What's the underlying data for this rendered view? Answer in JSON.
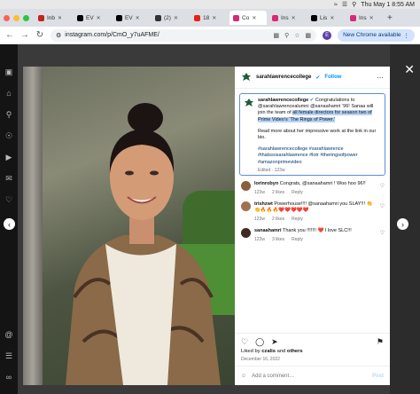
{
  "menubar": {
    "datetime": "Thu May 1  8:55 AM"
  },
  "tabs": [
    {
      "label": "Inb",
      "color": "#c5221f"
    },
    {
      "label": "EV",
      "color": "#000000"
    },
    {
      "label": "EV",
      "color": "#000000"
    },
    {
      "label": "(2)",
      "color": "#333333"
    },
    {
      "label": "18",
      "color": "#e62117"
    },
    {
      "label": "Co",
      "color": "#d62976",
      "active": true
    },
    {
      "label": "Ins",
      "color": "#d62976"
    },
    {
      "label": "Lis",
      "color": "#000000"
    },
    {
      "label": "Ins",
      "color": "#d62976"
    }
  ],
  "toolbar": {
    "url": "instagram.com/p/CmO_y7uAFME/",
    "profile_initial": "E",
    "update_label": "New Chrome available"
  },
  "post": {
    "username": "sarahlawrencecollege",
    "follow_label": "Follow",
    "caption_pre": "Congratulations to @sarahlawrencealumni @sanaahamri ’96! Sanaa will join the team of ",
    "caption_hl": "all female directors for season two of Prime Video’s ‘The Rings of Power.’",
    "caption_post": "Read more about her impressive work at the link in our bio.",
    "hashtags": "#sarahlawrencecollege #sarahlawrence #thatssosarahlawrence #lotr #theringsofpower #amazonprimevideo",
    "edited": "Edited · 123w",
    "comments": [
      {
        "user": "lorinrobyn",
        "text": "Congrats, @sanaahamri ! Woo hoo 96!!",
        "time": "123w",
        "likes": "2 likes",
        "reply": "Reply",
        "avatar": "#8b5e3c"
      },
      {
        "user": "trishzwt",
        "text": "Powerhouse!!!! @sanaahamri you SLAY!!! 👏👏🔥🔥🔥❤️❤️❤️❤️❤️",
        "time": "123w",
        "likes": "2 likes",
        "reply": "Reply",
        "avatar": "#a0714f"
      },
      {
        "user": "sanaahamri",
        "text": "Thank you !!!!!!! ❤️ I love SLC!!!",
        "time": "123w",
        "likes": "3 likes",
        "reply": "Reply",
        "avatar": "#3d2b22"
      }
    ],
    "likes_pre": "Liked by ",
    "likes_user": "czalis",
    "likes_mid": " and ",
    "likes_post": "others",
    "date": "December 16, 2022",
    "add_comment_placeholder": "Add a comment…",
    "post_label": "Post"
  },
  "colors": {
    "accent": "#0095f6",
    "highlight": "#b6d3f7"
  }
}
